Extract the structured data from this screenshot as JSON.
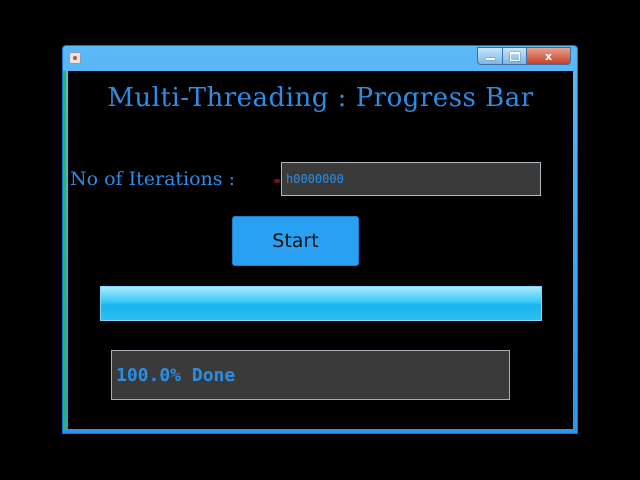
{
  "window": {
    "title": "",
    "close_glyph": "x",
    "icons": {
      "app": "java-app-icon",
      "minimize": "minimize-icon",
      "maximize": "maximize-icon",
      "close": "close-icon"
    }
  },
  "app": {
    "heading": "Multi-Threading : Progress Bar",
    "iterations_label": "No of Iterations :",
    "iterations_value": "h0000000",
    "start_label": "Start",
    "progress_percent": 100,
    "status_text": "100.0% Done"
  },
  "colors": {
    "text_accent": "#2a8de6",
    "button": "#2aa0f2",
    "progress_fill": "#2cc0f2",
    "field_bg": "#3a3a3a",
    "background": "#000000"
  }
}
